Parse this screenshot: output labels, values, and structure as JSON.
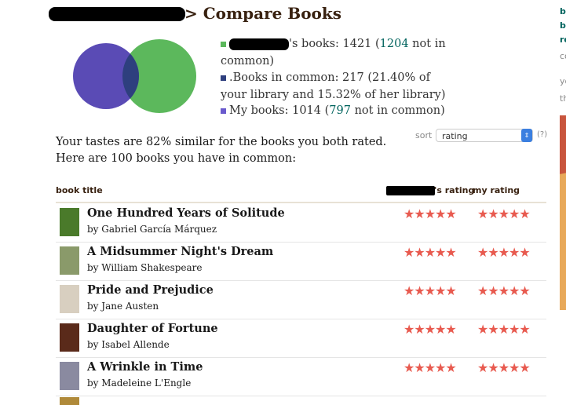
{
  "header": {
    "title": "> Compare Books"
  },
  "venn": {
    "their_color": "#5cb85c",
    "my_color": "#5a4bb5",
    "overlap_color": "#2e3f7e"
  },
  "legend": {
    "theirs_prefix": "'s books: 1421 (",
    "theirs_link": "1204",
    "theirs_suffix": " not in common)",
    "common": ".Books in common: 217 (21.40% of your library and 15.32% of her library)",
    "mine_prefix": "My books: 1014 (",
    "mine_link": "797",
    "mine_suffix": " not in common)"
  },
  "summary": "Your tastes are 82% similar for the books you both rated. Here are 100 books you have in common:",
  "sort": {
    "label": "sort",
    "value": "rating",
    "help": "(?)"
  },
  "table": {
    "col_title": "book title",
    "col_their": "'s rating",
    "col_mine": "my rating",
    "rows": [
      {
        "title": "One Hundred Years of Solitude",
        "author": "by Gabriel García Márquez",
        "their_rating": 5,
        "my_rating": 5,
        "cover": "#4a7a2a"
      },
      {
        "title": "A Midsummer Night's Dream",
        "author": "by William Shakespeare",
        "their_rating": 5,
        "my_rating": 5,
        "cover": "#8a9a6a"
      },
      {
        "title": "Pride and Prejudice",
        "author": "by Jane Austen",
        "their_rating": 5,
        "my_rating": 5,
        "cover": "#d8cfc0"
      },
      {
        "title": "Daughter of Fortune",
        "author": "by Isabel Allende",
        "their_rating": 5,
        "my_rating": 5,
        "cover": "#5a2a1a"
      },
      {
        "title": "A Wrinkle in Time",
        "author": "by Madeleine L'Engle",
        "their_rating": 5,
        "my_rating": 5,
        "cover": "#8a8aa0"
      }
    ]
  },
  "sidebar": {
    "lines": [
      "b",
      "b",
      "re",
      "co",
      "yo",
      "th"
    ]
  },
  "stars": "★★★★★"
}
